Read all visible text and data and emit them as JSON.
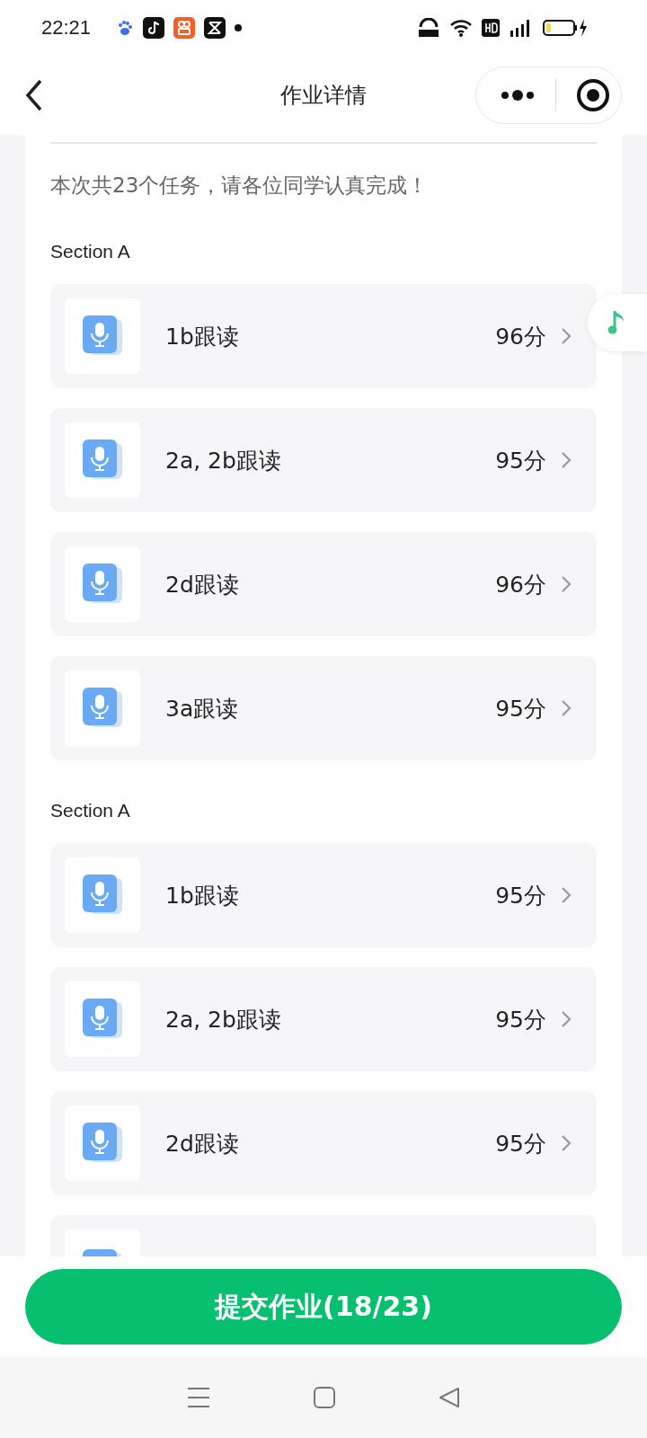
{
  "status_bar": {
    "time": "22:21"
  },
  "header": {
    "title": "作业详情"
  },
  "intro": "本次共23个任务，请各位同学认真完成！",
  "sections": [
    {
      "title": "Section A",
      "tasks": [
        {
          "name": "1b跟读",
          "score": "96分"
        },
        {
          "name": "2a, 2b跟读",
          "score": "95分"
        },
        {
          "name": "2d跟读",
          "score": "96分"
        },
        {
          "name": "3a跟读",
          "score": "95分"
        }
      ]
    },
    {
      "title": "Section A",
      "tasks": [
        {
          "name": "1b跟读",
          "score": "95分"
        },
        {
          "name": "2a, 2b跟读",
          "score": "95分"
        },
        {
          "name": "2d跟读",
          "score": "95分"
        }
      ],
      "cut_off_card": true
    }
  ],
  "submit_button": "提交作业(18/23)"
}
